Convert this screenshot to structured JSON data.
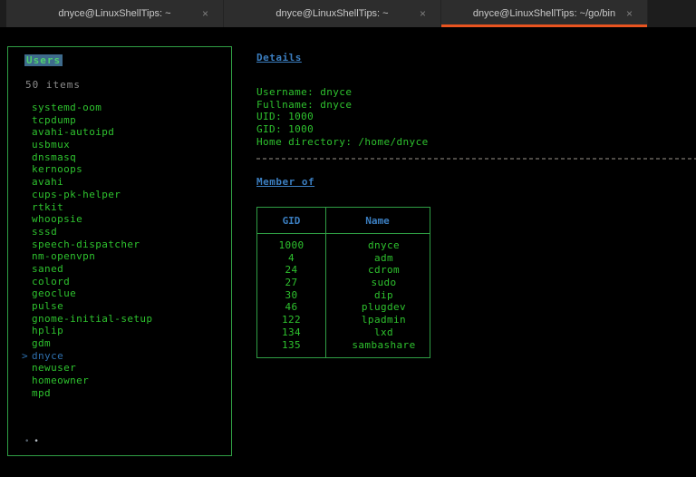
{
  "tabs": [
    {
      "label": "dnyce@LinuxShellTips: ~",
      "active": false
    },
    {
      "label": "dnyce@LinuxShellTips: ~",
      "active": false
    },
    {
      "label": "dnyce@LinuxShellTips: ~/go/bin",
      "active": true
    }
  ],
  "icons": {
    "close_glyph": "×",
    "page_dot": "•"
  },
  "left_panel": {
    "title": "Users",
    "count": "50 items",
    "selected": "dnyce",
    "selected_marker": ">",
    "items": [
      "systemd-oom",
      "tcpdump",
      "avahi-autoipd",
      "usbmux",
      "dnsmasq",
      "kernoops",
      "avahi",
      "cups-pk-helper",
      "rtkit",
      "whoopsie",
      "sssd",
      "speech-dispatcher",
      "nm-openvpn",
      "saned",
      "colord",
      "geoclue",
      "pulse",
      "gnome-initial-setup",
      "hplip",
      "gdm",
      "dnyce",
      "newuser",
      "homeowner",
      "mpd"
    ]
  },
  "details": {
    "title": "Details",
    "lines": [
      "Username: dnyce",
      "Fullname: dnyce",
      "UID: 1000",
      "GID: 1000",
      "Home directory: /home/dnyce"
    ]
  },
  "member_of": {
    "title": "Member of",
    "columns": [
      "GID",
      "Name"
    ],
    "rows": [
      [
        "1000",
        "dnyce"
      ],
      [
        "4",
        "adm"
      ],
      [
        "24",
        "cdrom"
      ],
      [
        "27",
        "sudo"
      ],
      [
        "30",
        "dip"
      ],
      [
        "46",
        "plugdev"
      ],
      [
        "122",
        "lpadmin"
      ],
      [
        "134",
        "lxd"
      ],
      [
        "135",
        "sambashare"
      ]
    ]
  },
  "colors": {
    "terminal_bg": "#000000",
    "tabbar_bg": "#1d1d1d",
    "tab_bg": "#2d2d2d",
    "tab_text": "#c9c9c9",
    "active_tab_underline": "#e95420",
    "green_text": "#2ec22e",
    "green_border": "#2f9e44",
    "header_blue": "#3b7ec0",
    "selected_blue": "#2e6fad",
    "title_highlight_bg": "#3e6b8c",
    "title_highlight_fg": "#4fd070",
    "muted_gray": "#8b8b8b",
    "dashed_line": "#4e4b46"
  }
}
